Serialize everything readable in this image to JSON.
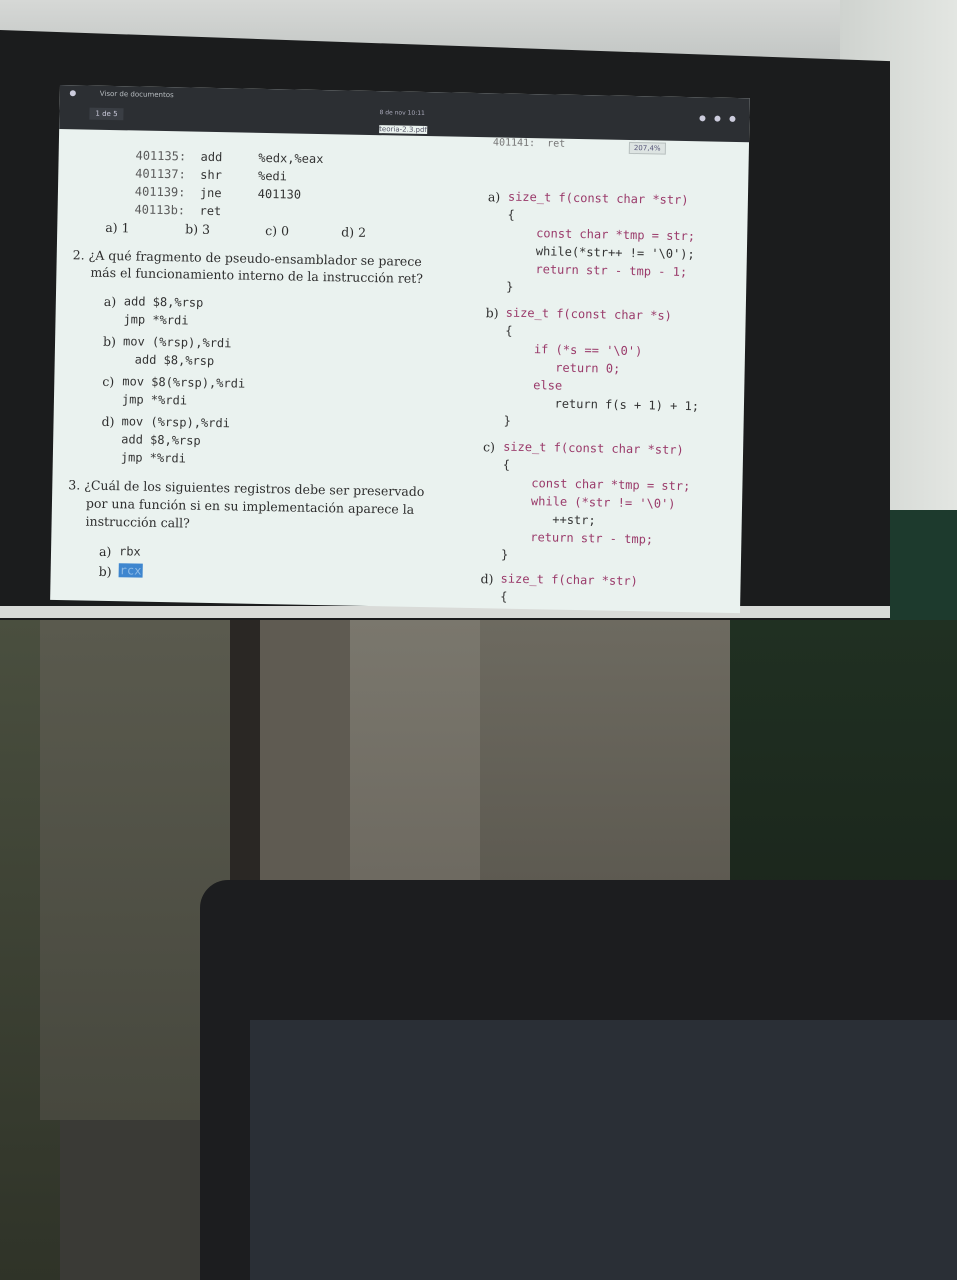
{
  "viewer": {
    "title": "Visor de documentos",
    "page_current": "1",
    "page_total": "de 5",
    "clock": "8 de nov 10:11",
    "filename": "teoria-2.3.pdf",
    "zoom": "207,4%"
  },
  "asm_listing": [
    {
      "addr": "401135:",
      "op": "add",
      "args": "%edx,%eax"
    },
    {
      "addr": "401137:",
      "op": "shr",
      "args": "%edi"
    },
    {
      "addr": "401139:",
      "op": "jne",
      "args": "401130"
    },
    {
      "addr": "40113b:",
      "op": "ret",
      "args": ""
    }
  ],
  "q1_options": [
    "a) 1",
    "b) 3",
    "c) 0",
    "d) 2"
  ],
  "q2": {
    "prompt_line1": "2. ¿A qué fragmento de pseudo-ensamblador se parece",
    "prompt_line2": "más el funcionamiento interno de la instrucción ret?",
    "options": [
      {
        "label": "a)",
        "lines": [
          "add $8,%rsp",
          "jmp *%rdi"
        ]
      },
      {
        "label": "b)",
        "lines": [
          "mov (%rsp),%rdi",
          "add $8,%rsp"
        ]
      },
      {
        "label": "c)",
        "lines": [
          "mov $8(%rsp),%rdi",
          "jmp *%rdi"
        ]
      },
      {
        "label": "d)",
        "lines": [
          "mov (%rsp),%rdi",
          "add $8,%rsp",
          "jmp *%rdi"
        ]
      }
    ]
  },
  "q3": {
    "prompt_line1": "3. ¿Cuál de los siguientes registros debe ser preservado",
    "prompt_line2": "por una función si en su implementación aparece la",
    "prompt_line3": "instrucción call?",
    "options": [
      {
        "label": "a)",
        "value": "rbx"
      },
      {
        "label": "b)",
        "value": "rcx"
      }
    ]
  },
  "right_top_cut": "401141:  ret",
  "c_options": [
    {
      "label": "a)",
      "lines": [
        "size_t f(const char *str)",
        "{",
        "    const char *tmp = str;",
        "    while(*str++ != '\\0');",
        "    return str - tmp - 1;",
        "}"
      ]
    },
    {
      "label": "b)",
      "lines": [
        "size_t f(const char *s)",
        "{",
        "    if (*s == '\\0')",
        "       return 0;",
        "    else",
        "       return f(s + 1) + 1;",
        "}"
      ]
    },
    {
      "label": "c)",
      "lines": [
        "size_t f(const char *str)",
        "{",
        "    const char *tmp = str;",
        "    while (*str != '\\0')",
        "       ++str;",
        "    return str - tmp;",
        "}"
      ]
    },
    {
      "label": "d)",
      "lines": [
        "size_t f(char *str)",
        "{"
      ]
    }
  ],
  "colors": {
    "highlight": "#3e86cf",
    "keyword": "#9a3a6a",
    "page_bg": "#eaf2ef"
  }
}
